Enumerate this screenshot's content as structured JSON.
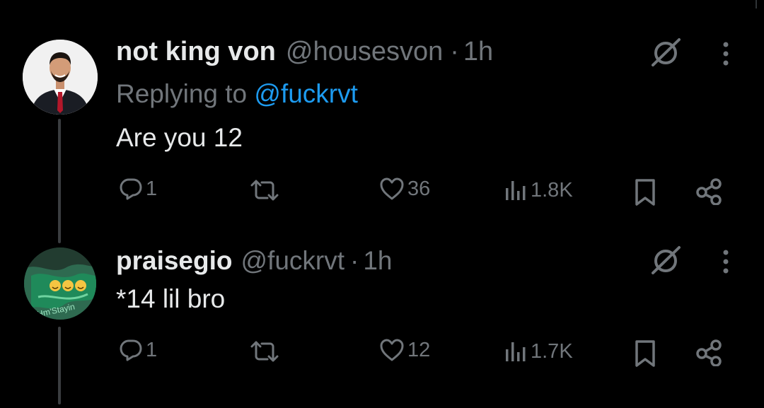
{
  "tweets": [
    {
      "name": "not king von",
      "handle": "@housesvon",
      "dot": "·",
      "time": "1h",
      "replying_prefix": "Replying to ",
      "replying_mention": "@fuckrvt",
      "text": "Are you 12",
      "replies": "1",
      "likes": "36",
      "views": "1.8K",
      "avatar_icon": "man-in-suit-avatar"
    },
    {
      "name": "praisegio",
      "handle": "@fuckrvt",
      "dot": "·",
      "time": "1h",
      "text": "*14 lil bro",
      "replies": "1",
      "likes": "12",
      "views": "1.7K",
      "avatar_icon": "green-flag-emoji-avatar",
      "avatar_emoji": "😹😹😹"
    }
  ],
  "colors": {
    "background": "#000000",
    "text": "#e7e9ea",
    "muted": "#71767b",
    "link": "#1d9bf0",
    "thread_line": "#3a3d40"
  }
}
